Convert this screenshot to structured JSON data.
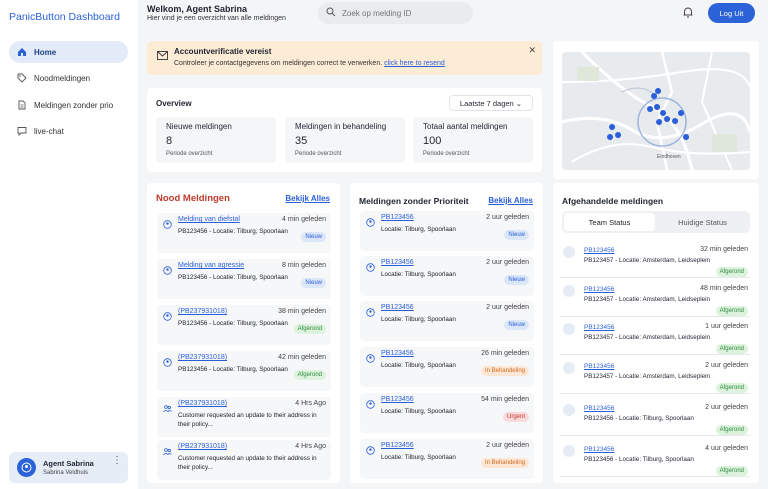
{
  "app": {
    "title": "PanicButton Dashboard"
  },
  "sidebar": {
    "items": [
      {
        "label": "Home",
        "icon": "home-icon",
        "active": true
      },
      {
        "label": "Noodmeldingen",
        "icon": "tag-icon"
      },
      {
        "label": "Meldingen zonder prio",
        "icon": "document-icon"
      },
      {
        "label": "live-chat",
        "icon": "chat-icon"
      }
    ]
  },
  "user": {
    "name": "Agent Sabrina",
    "fullname": "Sabrina Veldhuis"
  },
  "header": {
    "welcome": "Welkom, Agent Sabrina",
    "subtitle": "Hier vind je een overzicht van alle meldingen",
    "search_placeholder": "Zoek op melding ID",
    "logout_label": "Log Uit"
  },
  "alert": {
    "title": "Accountverificatie vereist",
    "message": "Controleer je contactgegevens om meldingen correct te verwerken.",
    "link": "click here to resend"
  },
  "overview": {
    "title": "Overview",
    "period": "Laatste 7 dagen",
    "stats": [
      {
        "label": "Nieuwe meldingen",
        "value": "8",
        "sub": "Periode overzicht"
      },
      {
        "label": "Meldingen in behandeling",
        "value": "35",
        "sub": "Periode overzicht"
      },
      {
        "label": "Totaal aantal meldingen",
        "value": "100",
        "sub": "Periode overzicht"
      }
    ]
  },
  "nood": {
    "title": "Nood Meldingen",
    "see_all": "Bekijk Alles",
    "items": [
      {
        "title": "Melding van diefstal",
        "time": "4 min geleden",
        "desc": "PB123456 - Locatie: Tilburg, Spoorlaan",
        "badge": "Nieuw",
        "icon": "user-circle-icon"
      },
      {
        "title": "Melding van agressie",
        "time": "8 min geleden",
        "desc": "PB123456 - Locatie: Tilburg, Spoorlaan",
        "badge": "Nieuw",
        "icon": "user-circle-icon"
      },
      {
        "title": "(PB237931018)",
        "time": "38 min geleden",
        "desc": "PB123456 - Locatie: Tilburg, Spoorlaan",
        "badge": "Afgerond",
        "icon": "user-circle-icon"
      },
      {
        "title": "(PB237931018)",
        "time": "42 min geleden",
        "desc": "PB123456 - Locatie: Tilburg, Spoorlaan",
        "badge": "Afgerond",
        "icon": "user-circle-icon"
      },
      {
        "title": "(PB237931018)",
        "time": "4 Hrs Ago",
        "desc": "Customer requested an update to their address in",
        "desc2": "their policy...",
        "icon": "users-icon"
      },
      {
        "title": "(PB237931018)",
        "time": "4 Hrs Ago",
        "desc": "Customer requested an update to their address in",
        "desc2": "their policy...",
        "icon": "users-icon"
      }
    ]
  },
  "zonder": {
    "title": "Meldingen zonder Prioriteit",
    "see_all": "Bekijk Alles",
    "items": [
      {
        "title": "PB123456",
        "time": "2 uur geleden",
        "desc": "Locatie: Tilburg, Spoorlaan",
        "badge": "Nieuw"
      },
      {
        "title": "PB123456",
        "time": "2 uur geleden",
        "desc": "Locatie: Tilburg, Spoorlaan",
        "badge": "Nieuw"
      },
      {
        "title": "PB123456",
        "time": "2 uur geleden",
        "desc": "Locatie: Tilburg, Spoorlaan",
        "badge": "Nieuw"
      },
      {
        "title": "PB123456",
        "time": "26 min geleden",
        "desc": "Locatie: Tilburg, Spoorlaan",
        "badge": "In Behandeling"
      },
      {
        "title": "PB123456",
        "time": "54 min geleden",
        "desc": "Locatie: Tilburg, Spoorlaan",
        "badge": "Urgent"
      },
      {
        "title": "PB123456",
        "time": "2 uur geleden",
        "desc": "Locatie: Tilburg, Spoorlaan",
        "badge": "In Behandeling"
      }
    ]
  },
  "afgehandeld": {
    "title": "Afgehandelde meldingen",
    "tabs": [
      "Team Status",
      "Huidige Status"
    ],
    "items": [
      {
        "id": "PB123456",
        "time": "32 min geleden",
        "desc": "PB123457 - Locatie: Amsterdam, Leidseplein",
        "badge": "Afgerond"
      },
      {
        "id": "PB123456",
        "time": "48 min geleden",
        "desc": "PB123457 - Locatie: Amsterdam, Leidseplein",
        "badge": "Afgerond"
      },
      {
        "id": "PB123456",
        "time": "1 uur geleden",
        "desc": "PB123457 - Locatie: Amsterdam, Leidseplein",
        "badge": "Afgerond"
      },
      {
        "id": "PB123456",
        "time": "2 uur geleden",
        "desc": "PB123457 - Locatie: Amsterdam, Leidseplein",
        "badge": "Afgerond"
      },
      {
        "id": "PB123456",
        "time": "2 uur geleden",
        "desc": "PB123456 - Locatie: Tilburg, Spoorlaan",
        "badge": "Afgerond"
      },
      {
        "id": "PB123456",
        "time": "4 uur geleden",
        "desc": "PB123456 - Locatie: Tilburg, Spoorlaan",
        "badge": "Afgerond"
      }
    ]
  },
  "map": {
    "label": "Eindhoven"
  },
  "colors": {
    "accent": "#2b62d8",
    "danger": "#c0392b",
    "success": "#2b8a3e",
    "warning": "#d2691e"
  }
}
